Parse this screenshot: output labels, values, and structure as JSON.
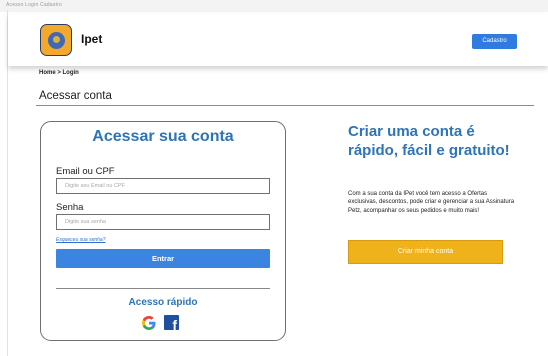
{
  "browser": {
    "strip_text": "Acesso Login Cadastro"
  },
  "header": {
    "brand": "Ipet",
    "signup_label": "Cadastro"
  },
  "breadcrumb": "Home > Login",
  "page": {
    "heading": "Acessar conta"
  },
  "login": {
    "title": "Acessar sua conta",
    "email_label": "Email ou CPF",
    "email_placeholder": "Digite seu Email ou CPF",
    "password_label": "Senha",
    "password_placeholder": "Digite sua senha",
    "forgot_label": "Esqueceu sua senha?",
    "enter_label": "Entrar",
    "quick_title": "Acesso rápido",
    "social": [
      "google-icon",
      "facebook-icon"
    ]
  },
  "promo": {
    "title": "Criar uma conta é rápido, fácil e gratuito!",
    "text": "Com a sua conta da IPet você tem acesso a Ofertas exclusivas, descontos, pode criar e gerenciar a sua Assinatura Petz, acompanhar os seus pedidos e muito mais!",
    "button_label": "Criar minha conta"
  },
  "colors": {
    "primary": "#2e74b8",
    "button_blue": "#3b84e0",
    "accent": "#f0b21a",
    "logo_bg": "#f3a92d"
  }
}
